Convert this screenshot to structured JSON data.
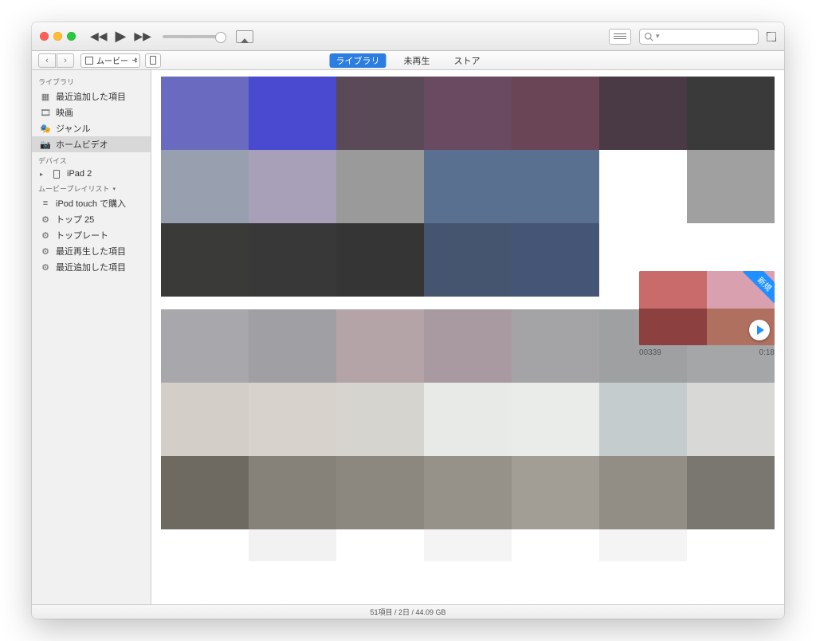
{
  "app_logo": "",
  "media_selector": "ムービー",
  "tabs": {
    "library": "ライブラリ",
    "unplayed": "未再生",
    "store": "ストア"
  },
  "sidebar": {
    "library_header": "ライブラリ",
    "recently_added": "最近追加した項目",
    "movies": "映画",
    "genres": "ジャンル",
    "home_videos": "ホームビデオ",
    "devices_header": "デバイス",
    "device_ipad": "iPad 2",
    "playlists_header": "ムービープレイリスト",
    "ipod_purchased": "iPod touch で購入",
    "top25": "トップ 25",
    "top_rated": "トップレート",
    "recently_played": "最近再生した項目",
    "recently_added2": "最近追加した項目"
  },
  "card": {
    "ribbon": "新規",
    "title": "00339",
    "duration": "0:18"
  },
  "statusbar": "51項目 / 2日 / 44.09 GB"
}
